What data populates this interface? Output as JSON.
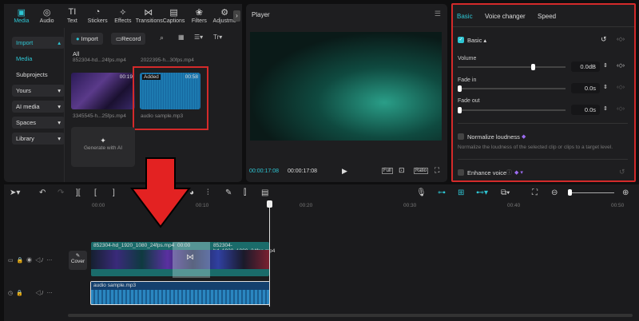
{
  "toolbar_tabs": [
    {
      "label": "Media",
      "icon": "media-icon"
    },
    {
      "label": "Audio",
      "icon": "audio-icon"
    },
    {
      "label": "Text",
      "icon": "text-icon"
    },
    {
      "label": "Stickers",
      "icon": "stickers-icon"
    },
    {
      "label": "Effects",
      "icon": "effects-icon"
    },
    {
      "label": "Transitions",
      "icon": "transitions-icon"
    },
    {
      "label": "Captions",
      "icon": "captions-icon"
    },
    {
      "label": "Filters",
      "icon": "filters-icon"
    },
    {
      "label": "Adjustme",
      "icon": "adjustment-icon"
    }
  ],
  "sidebar": {
    "import": "Import",
    "media": "Media",
    "subprojects": "Subprojects",
    "yours": "Yours",
    "ai_media": "AI media",
    "spaces": "Spaces",
    "library": "Library"
  },
  "media": {
    "import_btn": "Import",
    "record_btn": "Record",
    "filter_all": "All",
    "files": [
      {
        "name": "852304-hd...24fps.mp4"
      },
      {
        "name": "2022395-h...30fps.mp4"
      }
    ],
    "clip1": {
      "name": "3345545-h...25fps.mp4",
      "duration": "00:19"
    },
    "clip2": {
      "name": "audio sample.mp3",
      "duration": "00:58",
      "badge": "Added"
    },
    "generate": "Generate with AI"
  },
  "player": {
    "title": "Player",
    "current": "00:00:17:08",
    "total": "00:00:17:08",
    "full": "Full",
    "ratio": "Ratio"
  },
  "props": {
    "tabs": [
      "Basic",
      "Voice changer",
      "Speed"
    ],
    "section": "Basic",
    "volume_label": "Volume",
    "volume": "0.0dB",
    "volume_pct": 0.68,
    "fade_in_label": "Fade in",
    "fade_in": "0.0s",
    "fade_out_label": "Fade out",
    "fade_out": "0.0s",
    "normalize": "Normalize loudness",
    "normalize_desc": "Normalize the loudness of the selected clip or clips to a target level.",
    "enhance": "Enhance voice"
  },
  "timeline": {
    "ticks": [
      "00:00",
      "00:10",
      "00:20",
      "00:30",
      "00:40",
      "00:50"
    ],
    "cover": "Cover",
    "clip_a": "852304-hd_1920_1080_24fps.mp4",
    "transition": "00:00",
    "clip_b": "852304-hd_1920_1080_24fps.mp4",
    "audio": "audio sample.mp3"
  },
  "colors": {
    "accent": "#2ec6d4",
    "highlight": "#d42a2a"
  }
}
